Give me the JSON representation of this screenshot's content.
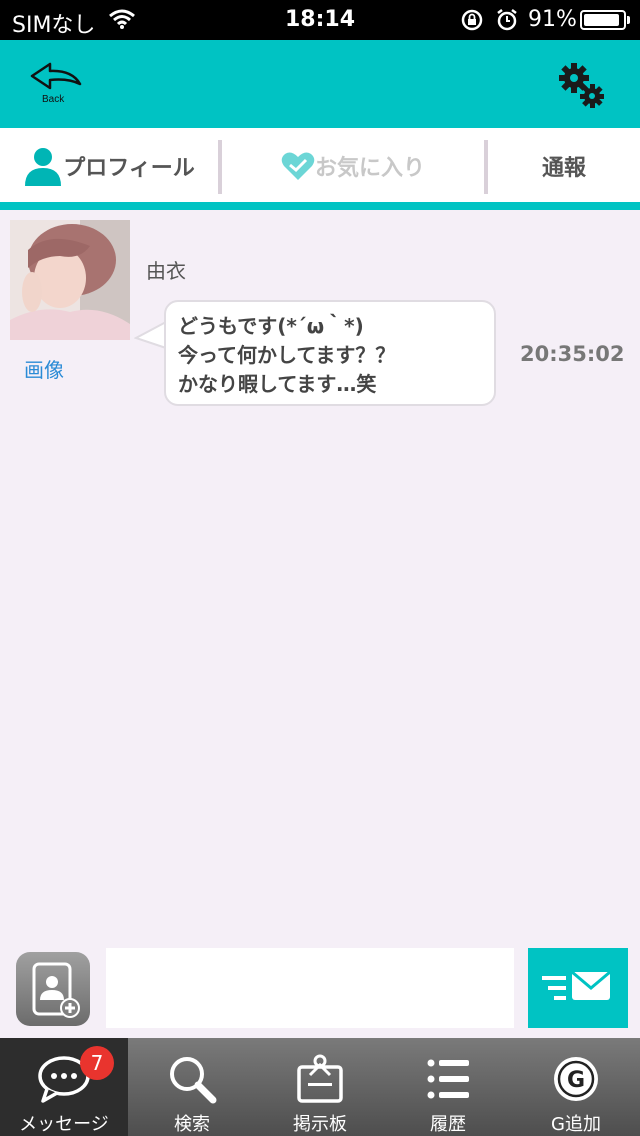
{
  "status_bar": {
    "carrier": "SIMなし",
    "time": "18:14",
    "battery_percent": "91%",
    "battery_level": 0.91
  },
  "header": {
    "back_label": "Back",
    "accent_color": "#00c3c3"
  },
  "tabs": [
    {
      "label": "プロフィール",
      "icon": "person-icon"
    },
    {
      "label": "お気に入り",
      "icon": "heart-check-icon"
    },
    {
      "label": "通報"
    }
  ],
  "chat": {
    "sender_name": "由衣",
    "image_link": "画像",
    "message": {
      "lines": [
        " どうもです(*´ω｀*)",
        "今って何かしてます？？",
        "かなり暇してます…笑"
      ],
      "time": "20:35:02"
    }
  },
  "composer": {
    "input_value": "",
    "photo_icon": "add-photo-icon",
    "send_icon": "send-mail-icon"
  },
  "bottom_nav": {
    "items": [
      {
        "label": "メッセージ",
        "icon": "chat-bubble-icon",
        "badge": "7",
        "active": true
      },
      {
        "label": "検索",
        "icon": "search-icon"
      },
      {
        "label": "掲示板",
        "icon": "clipboard-icon"
      },
      {
        "label": "履歴",
        "icon": "list-icon"
      },
      {
        "label": "G追加",
        "icon": "g-coin-icon"
      }
    ]
  }
}
